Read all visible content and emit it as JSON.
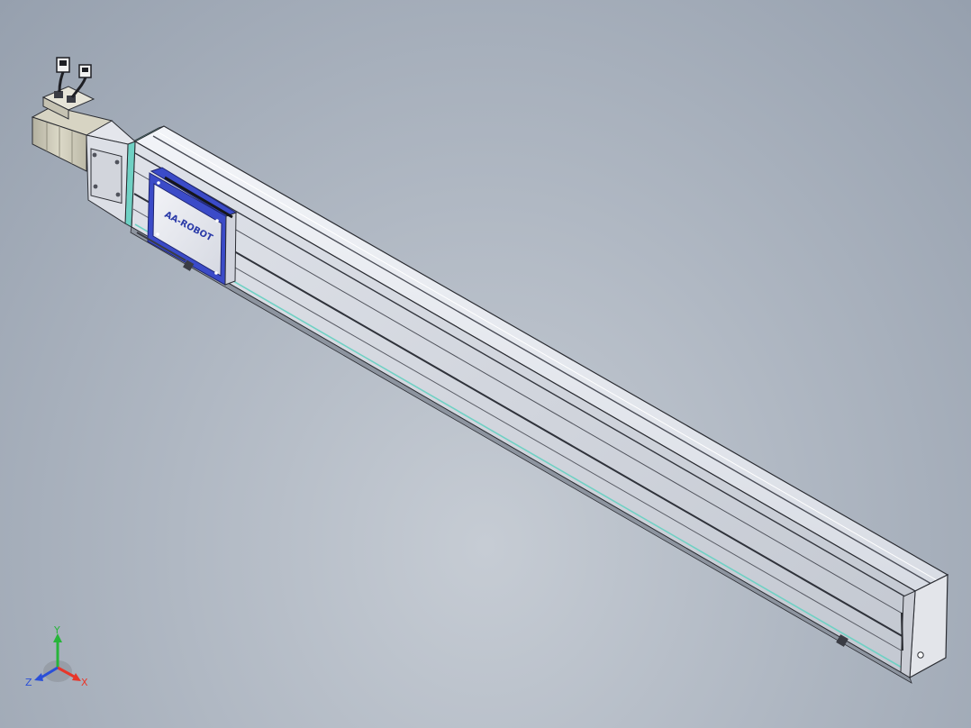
{
  "viewport": {
    "background_top": "#96a0ae",
    "background_bottom": "#c6ccd4"
  },
  "model": {
    "carriage_logo": "AA-ROBOT",
    "colors": {
      "rail_top": "#e9ecf2",
      "rail_side": "#dde1e8",
      "rail_face": "#c6cad2",
      "edge_dark": "#2b2d33",
      "accent_cyan": "#6fd1c4",
      "carriage_blue": "#3b4bc8",
      "carriage_face": "#e6e8ee",
      "motor_body": "#c9c6b4",
      "end_cap": "#e3e5ea"
    }
  },
  "triad": {
    "x_label": "X",
    "y_label": "Y",
    "z_label": "Z",
    "x_color": "#e8362a",
    "y_color": "#27b53a",
    "z_color": "#2a4fd8"
  }
}
